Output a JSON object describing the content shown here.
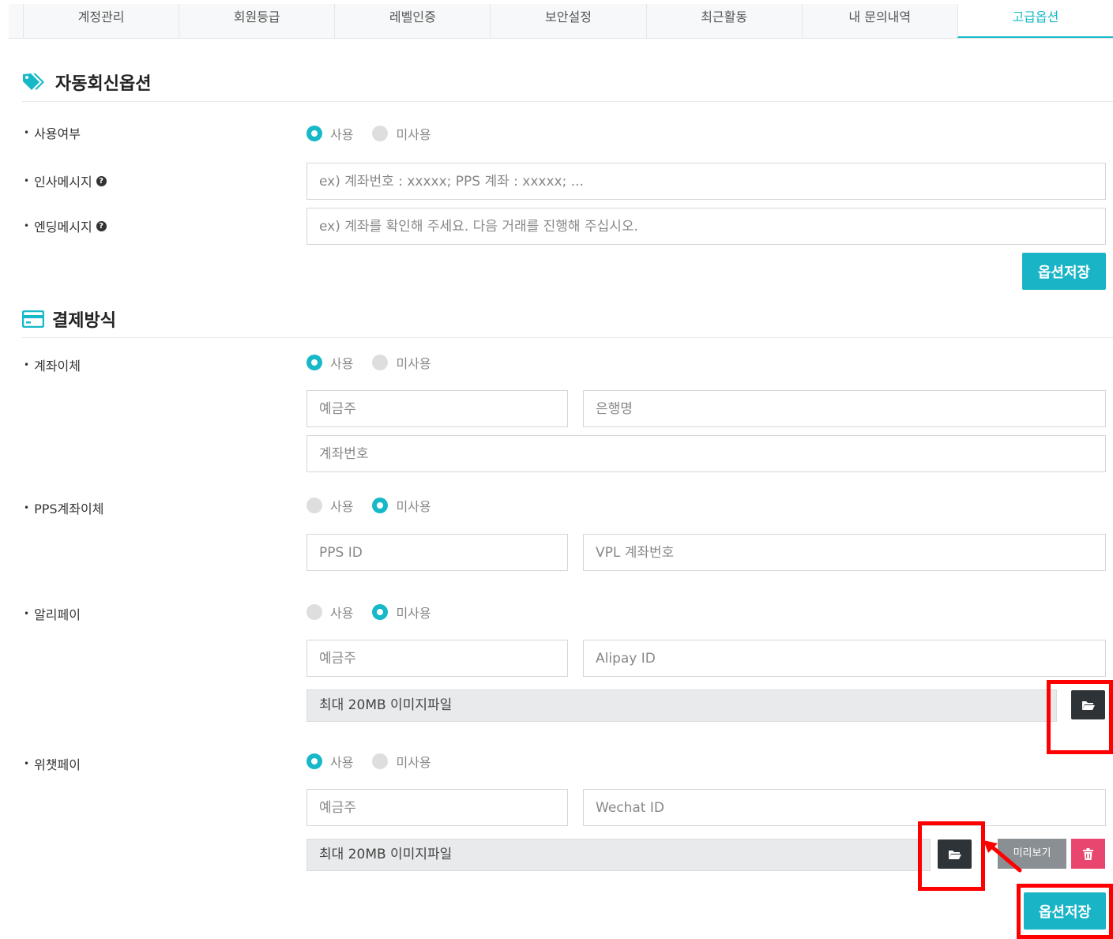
{
  "tabs": [
    {
      "label": "계정관리"
    },
    {
      "label": "회원등급"
    },
    {
      "label": "레벨인증"
    },
    {
      "label": "보안설정"
    },
    {
      "label": "최근활동"
    },
    {
      "label": "내 문의내역"
    },
    {
      "label": "고급옵션",
      "active": true
    }
  ],
  "auto_reply": {
    "title": "자동회신옵션",
    "usage_label": "사용여부",
    "greeting_label": "인사메시지",
    "greeting_placeholder": "ex) 계좌번호 : xxxxx; PPS 계좌 : xxxxx; ...",
    "ending_label": "엔딩메시지",
    "ending_placeholder": "ex) 계좌를 확인해 주세요. 다음 거래를 진행해 주십시오.",
    "use_selected": "use",
    "save_label": "옵션저장"
  },
  "radio_labels": {
    "use": "사용",
    "nouse": "미사용"
  },
  "payment": {
    "title": "결제방식",
    "bank": {
      "label": "계좌이체",
      "selected": "use",
      "holder_placeholder": "예금주",
      "bank_placeholder": "은행명",
      "account_placeholder": "계좌번호"
    },
    "pps": {
      "label": "PPS계좌이체",
      "selected": "nouse",
      "id_placeholder": "PPS ID",
      "vpl_placeholder": "VPL 계좌번호"
    },
    "alipay": {
      "label": "알리페이",
      "selected": "nouse",
      "holder_placeholder": "예금주",
      "id_placeholder": "Alipay ID",
      "file_text": "최대 20MB 이미지파일"
    },
    "wechat": {
      "label": "위챗페이",
      "selected": "use",
      "holder_placeholder": "예금주",
      "id_placeholder": "Wechat ID",
      "file_text": "최대 20MB 이미지파일",
      "preview_label": "미리보기"
    },
    "save_label": "옵션저장"
  },
  "colors": {
    "accent": "#17b9c9",
    "highlight": "#ff0000",
    "delete": "#e8466e"
  }
}
